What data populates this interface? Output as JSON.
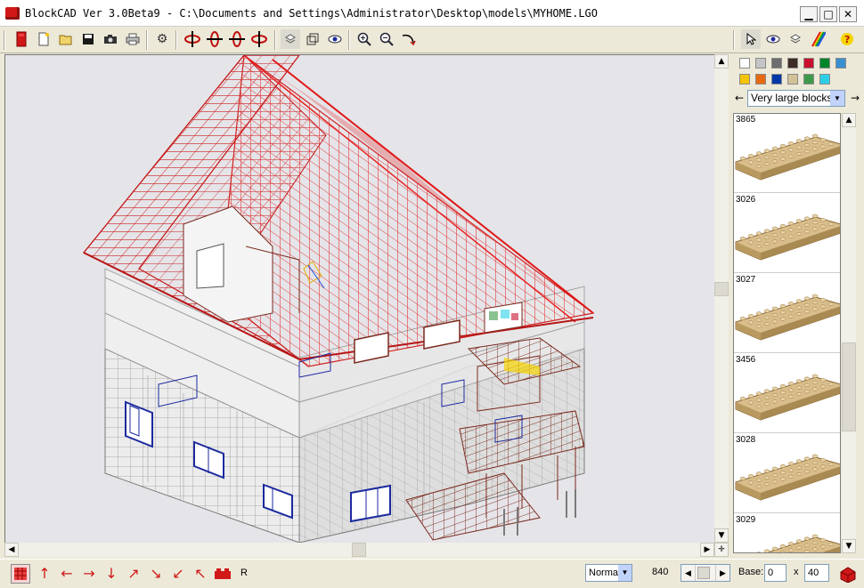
{
  "window": {
    "title": "BlockCAD Ver 3.0Beta9 - C:\\Documents and Settings\\Administrator\\Desktop\\models\\MYHOME.LGO",
    "minimize": "▁",
    "maximize": "□",
    "close": "✕"
  },
  "colors": {
    "roof": "#d21a1a",
    "wall": "#f4f4f4",
    "window_blue": "#1c2a9e",
    "brown": "#7a2a1e",
    "brick_tan": "#d9bd8a"
  },
  "toolbar": {
    "icons": [
      "brick-icon",
      "new-file-icon",
      "open-folder-icon",
      "save-disk-icon",
      "camera-icon",
      "print-icon",
      "settings-gear-icon",
      "rotate-left-icon",
      "rotate-up-icon",
      "rotate-down-icon",
      "rotate-right-icon",
      "layer-icon",
      "view-cube-icon",
      "eye-icon",
      "zoom-in-icon",
      "zoom-out-icon",
      "rotate-view-icon",
      "pointer-icon",
      "eye-icon",
      "layers-icon",
      "rainbow-color-icon",
      "help-icon"
    ]
  },
  "palette": [
    "#ffffff",
    "#c4c4c4",
    "#6d6d6d",
    "#3e2b24",
    "#c8102e",
    "#00852b",
    "#3a8fd1",
    "#f5c400",
    "#e86a10",
    "#0038a8",
    "#d4c197",
    "#3e9a4a",
    "#2bd0e8"
  ],
  "side": {
    "category": "Very large blocks",
    "parts": [
      {
        "id": "3865"
      },
      {
        "id": "3026"
      },
      {
        "id": "3027"
      },
      {
        "id": "3456"
      },
      {
        "id": "3028"
      },
      {
        "id": "3029"
      }
    ]
  },
  "statusbar": {
    "mode_value": "Norma",
    "count": "840",
    "base_label": "Base:",
    "base_x": "0",
    "x_label": "x",
    "base_y": "40",
    "r_label": "R"
  }
}
